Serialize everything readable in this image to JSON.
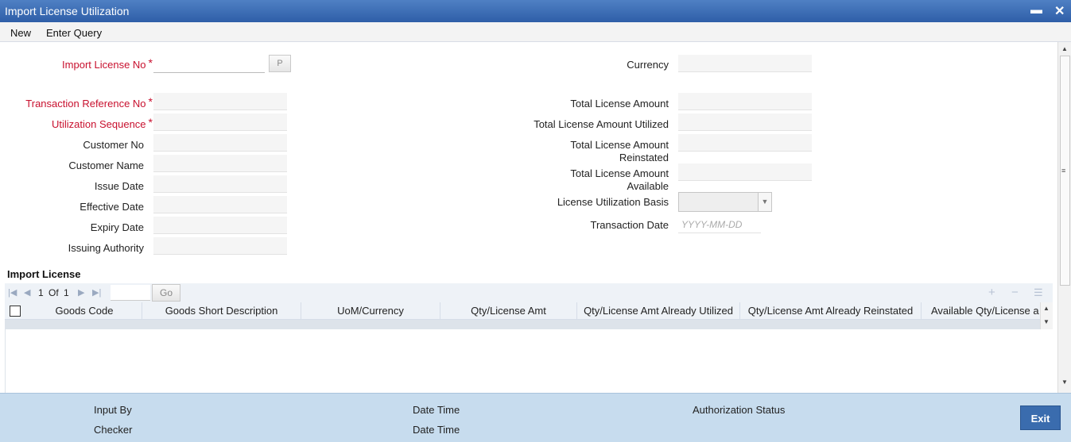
{
  "window": {
    "title": "Import License Utilization",
    "minimize": "▬",
    "close": "✕"
  },
  "menu": {
    "new": "New",
    "enter_query": "Enter Query"
  },
  "form": {
    "import_license_no": {
      "label": "Import License No",
      "required": "*",
      "value": ""
    },
    "p_button": "P",
    "transaction_reference_no": {
      "label": "Transaction Reference No",
      "required": "*",
      "value": ""
    },
    "utilization_sequence": {
      "label": "Utilization Sequence",
      "required": "*",
      "value": ""
    },
    "customer_no": {
      "label": "Customer No",
      "value": ""
    },
    "customer_name": {
      "label": "Customer Name",
      "value": ""
    },
    "issue_date": {
      "label": "Issue Date",
      "value": ""
    },
    "effective_date": {
      "label": "Effective Date",
      "value": ""
    },
    "expiry_date": {
      "label": "Expiry Date",
      "value": ""
    },
    "issuing_authority": {
      "label": "Issuing Authority",
      "value": ""
    },
    "currency": {
      "label": "Currency",
      "value": ""
    },
    "total_license_amount": {
      "label": "Total License Amount",
      "value": ""
    },
    "total_license_amount_utilized": {
      "label": "Total License Amount Utilized",
      "value": ""
    },
    "total_license_amount_reinstated": {
      "label_line1": "Total License Amount",
      "label_line2": "Reinstated",
      "value": ""
    },
    "total_license_amount_available": {
      "label_line1": "Total License Amount",
      "label_line2": "Available",
      "value": ""
    },
    "license_utilization_basis": {
      "label": "License Utilization Basis",
      "value": ""
    },
    "transaction_date": {
      "label": "Transaction Date",
      "placeholder": "YYYY-MM-DD"
    }
  },
  "import_license": {
    "title": "Import License",
    "pager": {
      "current": "1",
      "of": "Of",
      "total": "1",
      "go": "Go"
    },
    "columns": [
      "Goods Code",
      "Goods Short Description",
      "UoM/Currency",
      "Qty/License Amt",
      "Qty/License Amt Already Utilized",
      "Qty/License Amt Already Reinstated",
      "Available Qty/License a"
    ]
  },
  "footer": {
    "input_by": "Input By",
    "checker": "Checker",
    "date_time_1": "Date Time",
    "date_time_2": "Date Time",
    "authorization_status": "Authorization Status",
    "exit": "Exit"
  }
}
